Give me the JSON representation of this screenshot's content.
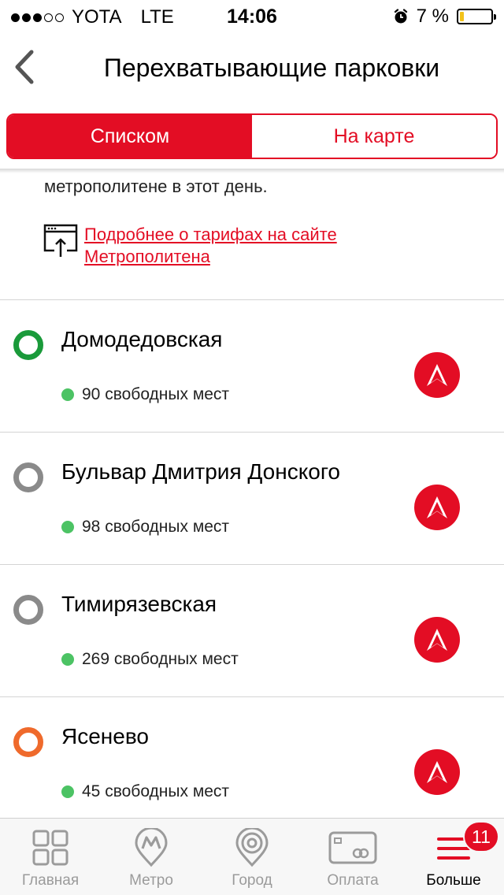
{
  "status_bar": {
    "carrier": "YOTA",
    "network": "LTE",
    "time": "14:06",
    "battery": "7 %",
    "signal_bars_filled": 3,
    "signal_bars_total": 5
  },
  "nav": {
    "title": "Перехватывающие парковки",
    "back_icon": "chevron-left-icon"
  },
  "segment": {
    "list_label": "Списком",
    "map_label": "На карте",
    "accent": "#e30d24"
  },
  "info": {
    "text": "метрополитене в этот день.",
    "link_line1": "Подробнее о тарифах на сайте",
    "link_line2": "Метрополитена",
    "link_icon": "browser-upload-icon"
  },
  "parkings": [
    {
      "station": "Домодедовская",
      "free": "90 свободных мест",
      "line_color": "#1a9a3a"
    },
    {
      "station": "Бульвар Дмитрия Донского",
      "free": "98 свободных мест",
      "line_color": "#8a8a8a"
    },
    {
      "station": "Тимирязевская",
      "free": "269 свободных мест",
      "line_color": "#8a8a8a"
    },
    {
      "station": "Ясенево",
      "free": "45 свободных мест",
      "line_color": "#ef6a2c"
    }
  ],
  "tabbar": {
    "tabs": [
      {
        "label": "Главная",
        "icon": "grid-icon"
      },
      {
        "label": "Метро",
        "icon": "metro-pin-icon"
      },
      {
        "label": "Город",
        "icon": "city-pin-icon"
      },
      {
        "label": "Оплата",
        "icon": "card-icon"
      },
      {
        "label": "Больше",
        "icon": "menu-icon"
      }
    ],
    "badge": "11"
  }
}
